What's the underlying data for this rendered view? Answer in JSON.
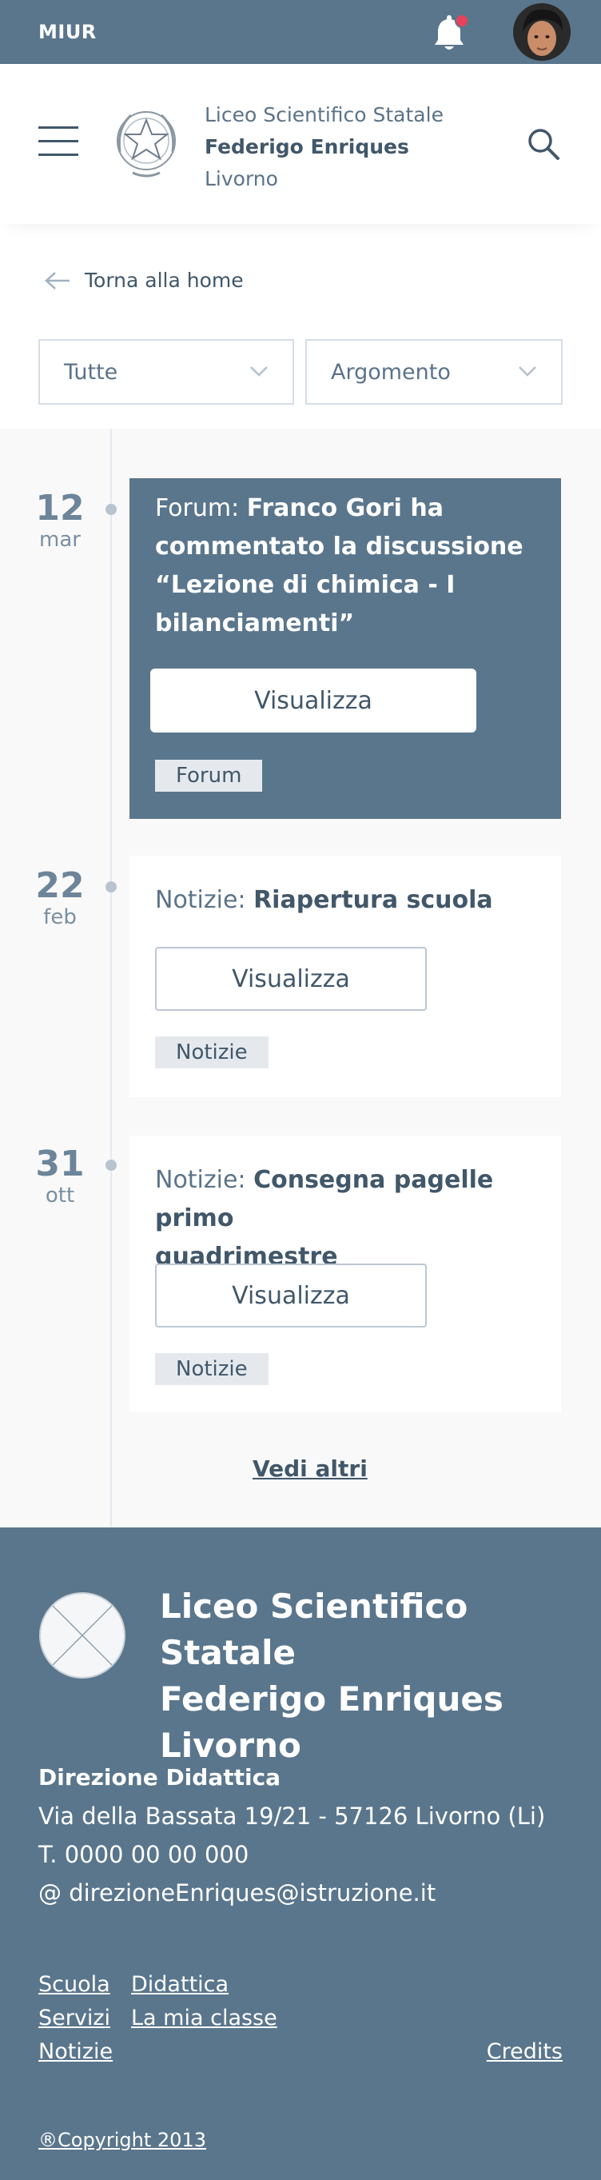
{
  "topbar": {
    "brand": "MIUR"
  },
  "header": {
    "school_line1": "Liceo Scientifico Statale",
    "school_line2": "Federigo Enriques",
    "school_line3": "Livorno"
  },
  "back": {
    "label": "Torna alla home"
  },
  "filters": [
    {
      "label": "Tutte"
    },
    {
      "label": "Argomento"
    }
  ],
  "timeline": {
    "items": [
      {
        "day": "12",
        "month": "mar",
        "prefix": "Forum: ",
        "title_line1": "Franco Gori ha",
        "title_line2": "commentato la discussione",
        "title_line3": "“Lezione di chimica - I",
        "title_line4": "bilanciamenti”",
        "button": "Visualizza",
        "tag": "Forum"
      },
      {
        "day": "22",
        "month": "feb",
        "prefix": "Notizie: ",
        "title_line1": "Riapertura scuola",
        "button": "Visualizza",
        "tag": "Notizie"
      },
      {
        "day": "31",
        "month": "ott",
        "prefix": "Notizie: ",
        "title_line1": "Consegna pagelle primo",
        "title_line2": "quadrimestre",
        "button": "Visualizza",
        "tag": "Notizie"
      }
    ],
    "more": "Vedi altri"
  },
  "footer": {
    "name_line1": "Liceo Scientifico Statale",
    "name_line2": "Federigo Enriques",
    "name_line3": "Livorno",
    "direction": "Direzione Didattica",
    "address": "Via della Bassata 19/21 - 57126 Livorno (Li)",
    "phone": "T. 0000 00 00 000",
    "email": "@ direzioneEnriques@istruzione.it",
    "links": {
      "scuola": "Scuola",
      "didattica": "Didattica",
      "servizi": "Servizi",
      "classe": "La mia classe",
      "notizie": "Notizie",
      "credits": "Credits"
    },
    "copyright": "®Copyright 2013"
  },
  "colors": {
    "primary": "#5a768c",
    "text": "#41576a",
    "notification": "#e8425b"
  }
}
